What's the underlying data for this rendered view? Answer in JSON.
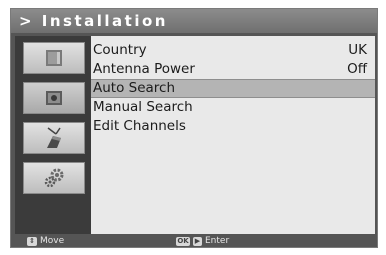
{
  "header": {
    "title": "> Installation"
  },
  "sidebar": {
    "items": [
      {
        "icon": "tv-screen-icon"
      },
      {
        "icon": "satellite-receiver-icon"
      },
      {
        "icon": "antenna-installation-icon"
      },
      {
        "icon": "settings-gear-icon"
      }
    ]
  },
  "menu": {
    "items": [
      {
        "label": "Country",
        "value": "UK"
      },
      {
        "label": "Antenna Power",
        "value": "Off"
      },
      {
        "label": "Auto Search",
        "value": ""
      },
      {
        "label": "Manual Search",
        "value": ""
      },
      {
        "label": "Edit Channels",
        "value": ""
      }
    ],
    "selected_index": 2
  },
  "footer": {
    "move_label": "Move",
    "ok_key": "OK",
    "enter_label": "Enter"
  }
}
